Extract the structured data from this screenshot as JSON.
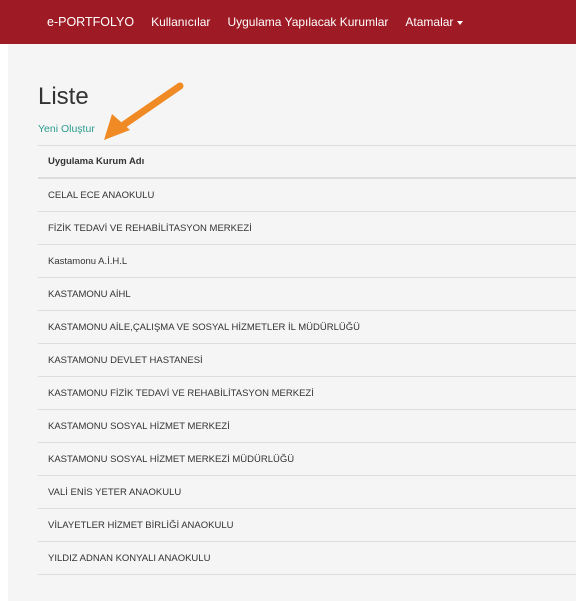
{
  "navbar": {
    "brand": "e-PORTFOLYO",
    "items": [
      {
        "label": "Kullanıcılar"
      },
      {
        "label": "Uygulama Yapılacak Kurumlar"
      },
      {
        "label": "Atamalar"
      }
    ]
  },
  "page": {
    "title": "Liste",
    "new_link": "Yeni Oluştur"
  },
  "table": {
    "header": "Uygulama Kurum Adı",
    "rows": [
      "CELAL ECE ANAOKULU",
      "FİZİK TEDAVİ VE REHABİLİTASYON MERKEZİ",
      "Kastamonu A.İ.H.L",
      "KASTAMONU AİHL",
      "KASTAMONU AİLE,ÇALIŞMA VE SOSYAL HİZMETLER İL MÜDÜRLÜĞÜ",
      "KASTAMONU DEVLET HASTANESİ",
      "KASTAMONU FİZİK TEDAVİ VE REHABİLİTASYON MERKEZİ",
      "KASTAMONU SOSYAL HİZMET MERKEZİ",
      "KASTAMONU SOSYAL HİZMET MERKEZİ MÜDÜRLÜĞÜ",
      "VALİ ENİS YETER ANAOKULU",
      "VİLAYETLER HİZMET BİRLİĞİ ANAOKULU",
      "YILDIZ ADNAN KONYALI ANAOKULU"
    ]
  },
  "colors": {
    "navbar": "#9e1a24",
    "link": "#2a9d8f",
    "arrow": "#f08a24"
  },
  "annotation": {
    "icon": "arrow-icon"
  }
}
